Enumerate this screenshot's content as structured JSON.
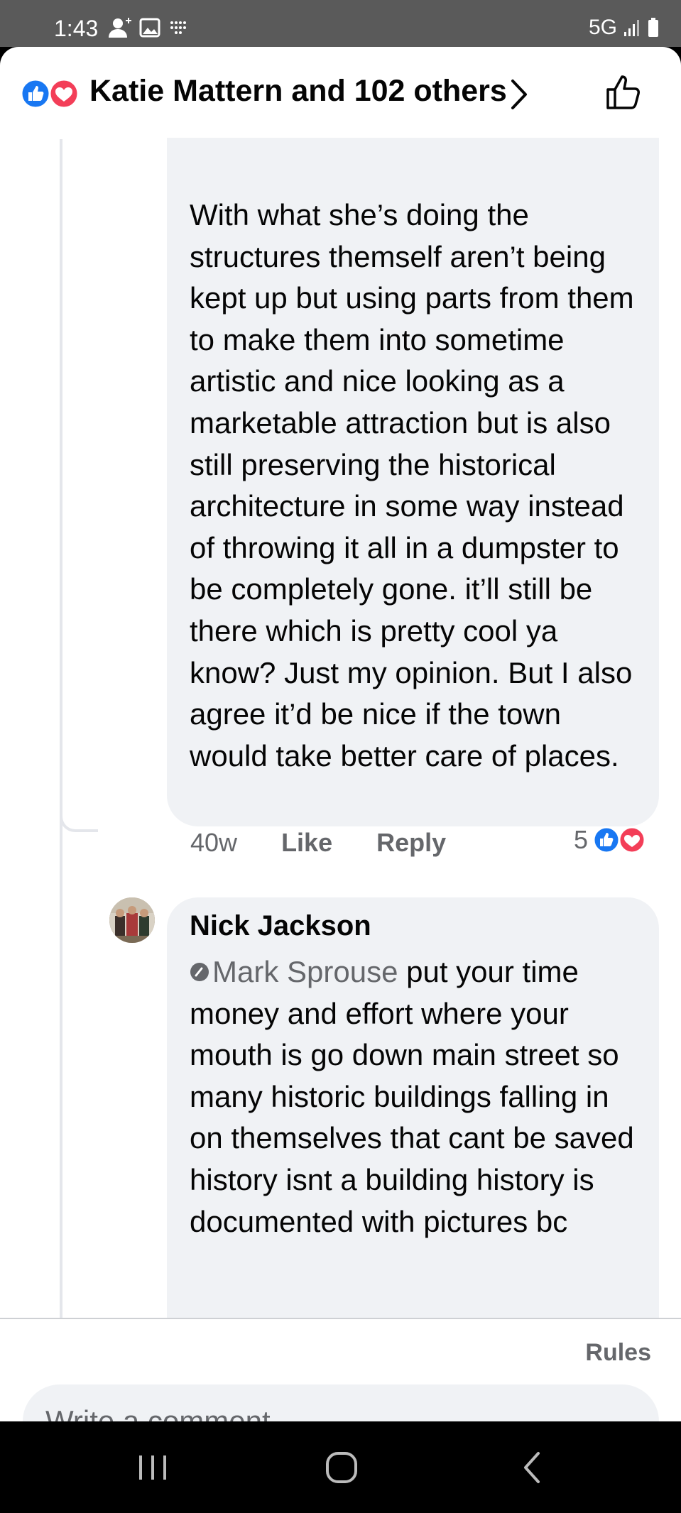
{
  "status_bar": {
    "time": "1:43",
    "network": "5G"
  },
  "header": {
    "reactors": "Katie Mattern and 102 others"
  },
  "comment1": {
    "text": "With what she’s doing the structures themself aren’t being kept up but using parts from them to make them into sometime artistic and nice looking as a marketable attraction but is also still preserving the historical architecture in some way instead of throwing it all in a dumpster to be completely gone. it’ll still be there which is pretty cool ya know? Just my opinion. But I also agree it’d be nice if the town would take better care of places.",
    "time": "40w",
    "like_label": "Like",
    "reply_label": "Reply",
    "reaction_count": "5"
  },
  "comment2": {
    "author": "Nick Jackson",
    "mention": "Mark Sprouse",
    "text": " put your time money and effort where your mouth is go down main street so many historic buildings falling in on themselves that cant be saved history isnt a building history is documented with pictures bc"
  },
  "footer": {
    "rules_label": "Rules",
    "comment_placeholder": "Write a comment…"
  },
  "colors": {
    "like_blue": "#1877f2",
    "love_red": "#f33e58",
    "bubble_bg": "#f0f2f5",
    "muted_text": "#65676b"
  }
}
